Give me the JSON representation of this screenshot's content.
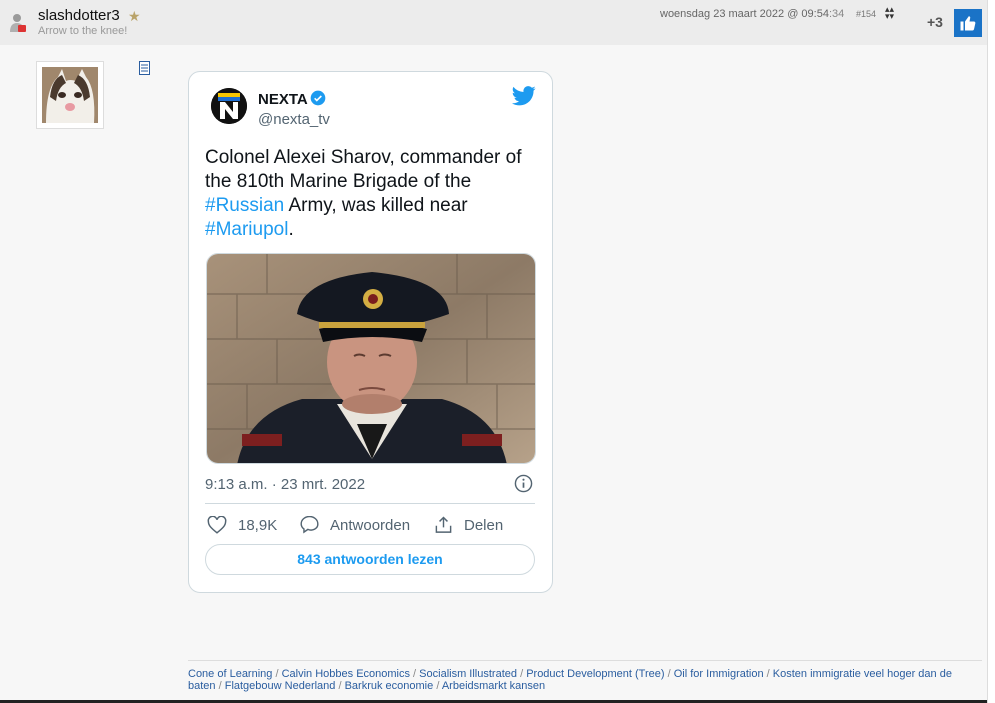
{
  "header": {
    "username": "slashdotter3",
    "tagline": "Arrow to the knee!",
    "date_prefix": "woensdag 23 maart 2022 @ 09:54",
    "date_seconds": ":34",
    "post_number": "#154",
    "score": "+3"
  },
  "tweet": {
    "name": "NEXTA",
    "handle": "@nexta_tv",
    "text_part1": "Colonel Alexei Sharov, commander of the 810th Marine Brigade of the ",
    "hashtag1": "#Russian",
    "text_part2": " Army, was killed near ",
    "hashtag2": "#Mariupol",
    "text_part3": ".",
    "timestamp": "9:13 a.m. · 23 mrt. 2022",
    "likes": "18,9K",
    "reply_label": "Antwoorden",
    "share_label": "Delen",
    "read_replies": "843 antwoorden lezen"
  },
  "footer": {
    "links": [
      "Cone of Learning",
      "Calvin Hobbes Economics",
      "Socialism Illustrated",
      "Product Development (Tree)",
      "Oil for Immigration",
      "Kosten immigratie veel hoger dan de baten",
      "Flatgebouw Nederland",
      "Barkruk economie",
      "Arbeidsmarkt kansen"
    ]
  },
  "colors": {
    "accent": "#1d9bf0",
    "like_button": "#1a73c7",
    "link": "#2a5d9f"
  }
}
